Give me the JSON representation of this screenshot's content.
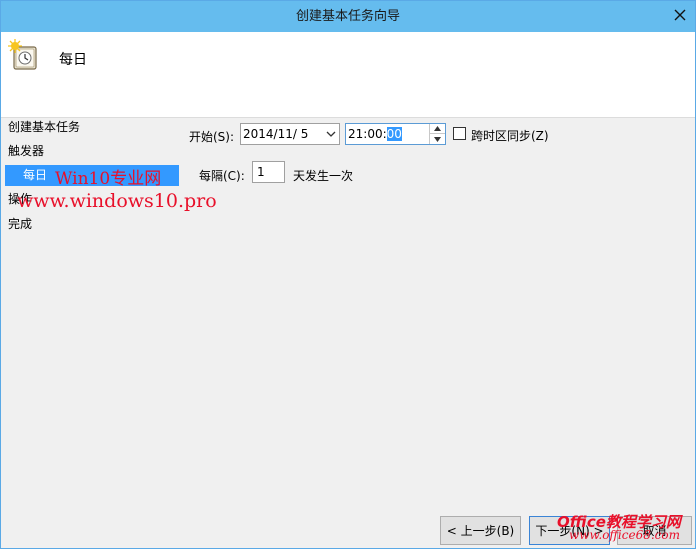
{
  "window": {
    "title": "创建基本任务向导"
  },
  "header": {
    "title": "每日"
  },
  "steps": [
    {
      "label": "创建基本任务"
    },
    {
      "label": "触发器"
    },
    {
      "label": "每日"
    },
    {
      "label": "操作"
    },
    {
      "label": "完成"
    }
  ],
  "form": {
    "start_label": "开始(S):",
    "start_date": "2014/11/  5",
    "start_time_prefix": "21:00:",
    "start_time_selected": "00",
    "sync_label": "跨时区同步(Z)",
    "interval_label": "每隔(C):",
    "interval_value": "1",
    "interval_suffix": "天发生一次"
  },
  "buttons": {
    "back": "< 上一步(B)",
    "next": "下一步(N) >",
    "cancel": "取消"
  },
  "watermarks": {
    "win10_title": "Win10专业网",
    "win10_url": "www.windows10.pro",
    "office_title": "Office教程学习网",
    "office_url": "www.office68.com"
  },
  "colors": {
    "titlebar": "#65bcee",
    "selection": "#3399ff",
    "watermark": "#e8102a"
  }
}
